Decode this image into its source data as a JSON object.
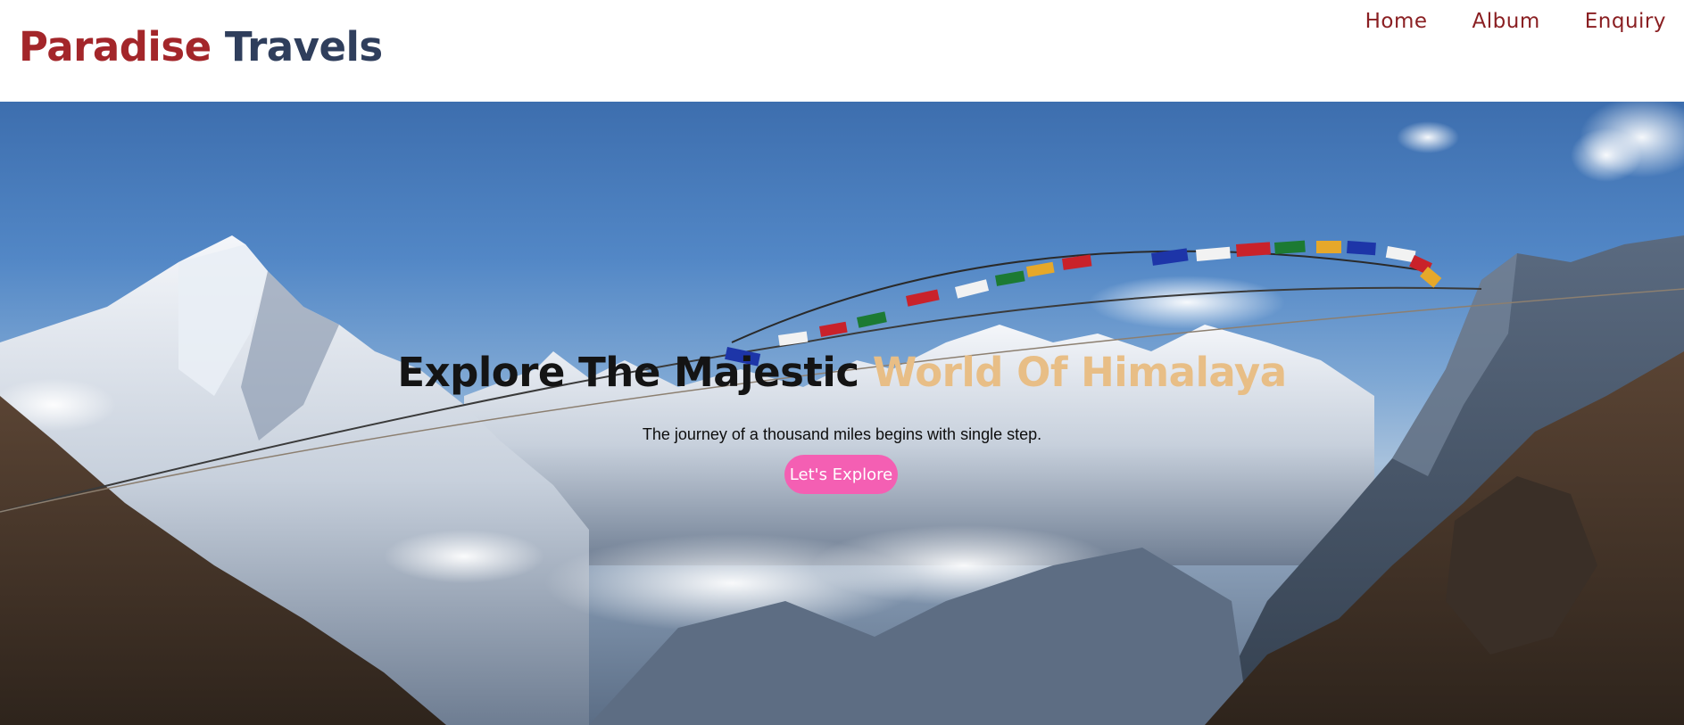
{
  "brand": {
    "word1": "Paradise",
    "word2": "Travels",
    "color_primary": "#a3262a",
    "color_secondary": "#2f3e5c"
  },
  "nav": {
    "items": [
      {
        "label": "Home"
      },
      {
        "label": "Album"
      },
      {
        "label": "Enquiry"
      }
    ],
    "color": "#8a1f22"
  },
  "hero": {
    "title_part1": "Explore The Majestic",
    "title_part2": "World Of Himalaya",
    "subtitle": "The journey of a thousand miles begins with single step.",
    "cta_label": "Let's Explore",
    "cta_color": "#f45fb3",
    "accent_color": "#e8be86",
    "background_image": "himalaya-mountains-with-prayer-flags"
  }
}
